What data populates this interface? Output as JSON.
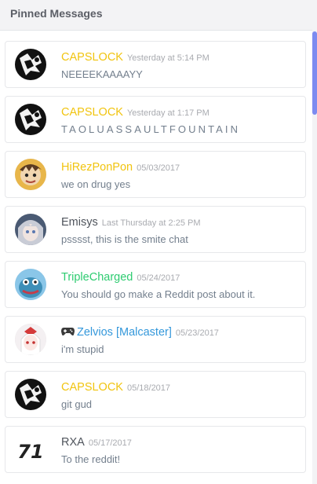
{
  "header": {
    "title": "Pinned Messages"
  },
  "colors": {
    "yellow": "#f1c40f",
    "green": "#2ecc71",
    "blue": "#3498db",
    "default": "#4f545c"
  },
  "messages": [
    {
      "author": "CAPSLOCK",
      "color": "#f1c40f",
      "timestamp": "Yesterday at 5:14 PM",
      "text": "NEEEEKAAAAYY",
      "avatar": "capslock-avatar"
    },
    {
      "author": "CAPSLOCK",
      "color": "#f1c40f",
      "timestamp": "Yesterday at 1:17 PM",
      "text": "TAOLUASSAULTFOUNTAIN",
      "avatar": "capslock-avatar"
    },
    {
      "author": "HiRezPonPon",
      "color": "#f1c40f",
      "timestamp": "05/03/2017",
      "text": "we on drug yes",
      "avatar": "hirez-avatar"
    },
    {
      "author": "Emisys",
      "color": "#4f545c",
      "timestamp": "Last Thursday at 2:25 PM",
      "text": "psssst, this is the smite chat",
      "avatar": "emisys-avatar"
    },
    {
      "author": "TripleCharged",
      "color": "#2ecc71",
      "timestamp": "05/24/2017",
      "text": "You should go make a Reddit post about it.",
      "avatar": "triplecharged-avatar"
    },
    {
      "author": "Zelvios [Malcaster]",
      "color": "#3498db",
      "timestamp": "05/23/2017",
      "text": "i'm stupid",
      "avatar": "zelvios-avatar",
      "icon": "game-controller-icon"
    },
    {
      "author": "CAPSLOCK",
      "color": "#f1c40f",
      "timestamp": "05/18/2017",
      "text": "git gud",
      "avatar": "capslock-avatar"
    },
    {
      "author": "RXA",
      "color": "#4f545c",
      "timestamp": "05/17/2017",
      "text": "To the reddit!",
      "avatar": "rxa-avatar",
      "avatar_text": "71"
    }
  ]
}
